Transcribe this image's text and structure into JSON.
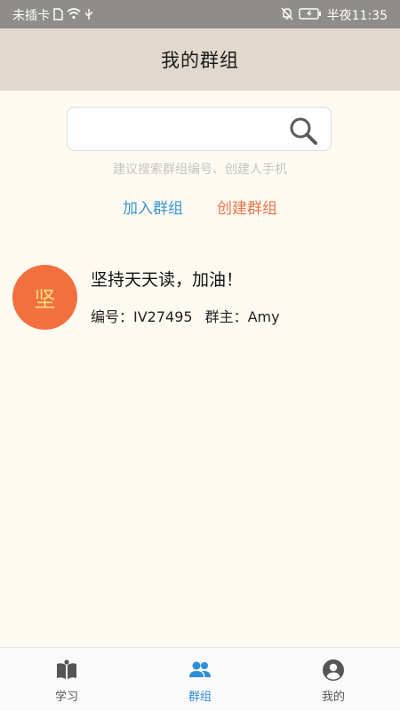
{
  "status_bar": {
    "carrier": "未插卡",
    "time": "半夜11:35"
  },
  "header": {
    "title": "我的群组"
  },
  "search": {
    "placeholder": "",
    "hint": "建议搜索群组编号、创建人手机"
  },
  "actions": {
    "join_label": "加入群组",
    "create_label": "创建群组"
  },
  "groups": [
    {
      "avatar_char": "坚",
      "name": "坚持天天读，加油！",
      "id_text": "编号：IV27495",
      "owner_text": "群主：Amy"
    }
  ],
  "tabs": [
    {
      "label": "学习",
      "icon": "book-icon",
      "active": false
    },
    {
      "label": "群组",
      "icon": "group-icon",
      "active": true
    },
    {
      "label": "我的",
      "icon": "profile-icon",
      "active": false
    }
  ],
  "colors": {
    "header_bg": "#e1d9ce",
    "page_bg": "#fffbf2",
    "join": "#3a97d4",
    "create": "#e8744a",
    "avatar_bg": "#f2703f",
    "avatar_text": "#ffe27a",
    "tab_active": "#2f8fd6"
  }
}
